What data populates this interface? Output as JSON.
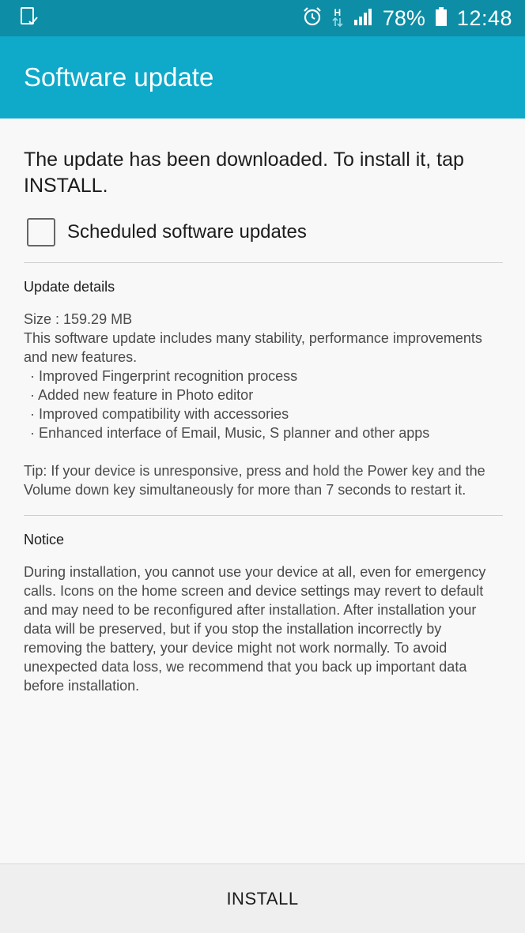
{
  "status_bar": {
    "battery_percent": "78%",
    "time": "12:48",
    "network_label": "H",
    "icons": [
      "screenshot-icon",
      "alarm-icon",
      "data-arrows-icon",
      "signal-icon",
      "battery-icon"
    ]
  },
  "app_bar": {
    "title": "Software update"
  },
  "main": {
    "headline": "The update has been downloaded. To install it, tap INSTALL.",
    "scheduled_checkbox": {
      "label": "Scheduled software updates",
      "checked": false
    },
    "update_details": {
      "title": "Update details",
      "size": "Size : 159.29 MB",
      "summary": "This software update includes many stability, performance improvements and new features.",
      "bullets": [
        "· Improved Fingerprint recognition process",
        "· Added new feature in Photo editor",
        "· Improved compatibility with accessories",
        "· Enhanced interface of Email, Music, S planner and other apps"
      ],
      "tip": "Tip: If your device is unresponsive, press and hold the Power key and the Volume down key simultaneously for more than 7 seconds to restart it."
    },
    "notice": {
      "title": "Notice",
      "text": "During installation, you cannot use your device at all, even for emergency calls. Icons on the home screen and device settings may revert to default and may need to be reconfigured after installation. After installation your data will be preserved, but if you stop the installation incorrectly by removing the battery, your device might not work normally. To avoid unexpected data loss, we recommend that you back up important data before installation."
    }
  },
  "bottom_bar": {
    "install_label": "INSTALL"
  },
  "colors": {
    "status_bar": "#0d8ea6",
    "app_bar": "#0fa9c9",
    "background": "#f8f8f8"
  }
}
